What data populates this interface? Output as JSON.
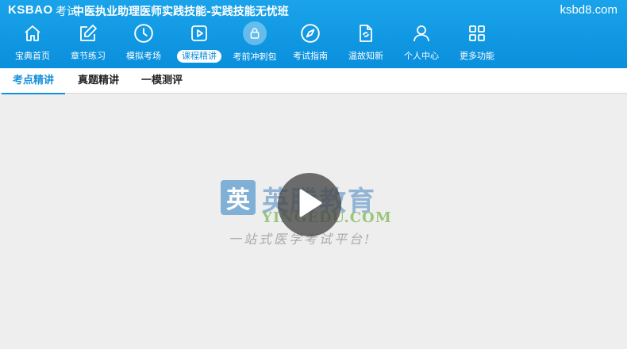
{
  "header": {
    "brand": "KSBAO",
    "brand_suffix": "考试",
    "course_title": "中医执业助理医师实践技能-实践技能无忧班",
    "site_url": "ksbd8.com",
    "background_color": "#1aa3ea"
  },
  "nav": {
    "active_index": 3,
    "items": [
      {
        "label": "宝典首页",
        "icon": "home-icon"
      },
      {
        "label": "章节练习",
        "icon": "edit-icon"
      },
      {
        "label": "模拟考场",
        "icon": "clock-icon"
      },
      {
        "label": "课程精讲",
        "icon": "video-play-icon"
      },
      {
        "label": "考前冲刺包",
        "icon": "lock-icon"
      },
      {
        "label": "考试指南",
        "icon": "compass-icon"
      },
      {
        "label": "温故知新",
        "icon": "refresh-doc-icon"
      },
      {
        "label": "个人中心",
        "icon": "user-icon"
      },
      {
        "label": "更多功能",
        "icon": "grid-icon"
      }
    ]
  },
  "tabs": {
    "items": [
      {
        "label": "考点精讲"
      },
      {
        "label": "真题精讲"
      },
      {
        "label": "一模测评"
      }
    ],
    "active_index": 0,
    "accent_color": "#1590dc"
  },
  "video": {
    "watermark": {
      "logo_char": "英",
      "name": "英腾教育",
      "domain": "YINGEDU.COM",
      "slogan": "一站式医学考试平台!"
    },
    "play_icon": "play-icon"
  }
}
